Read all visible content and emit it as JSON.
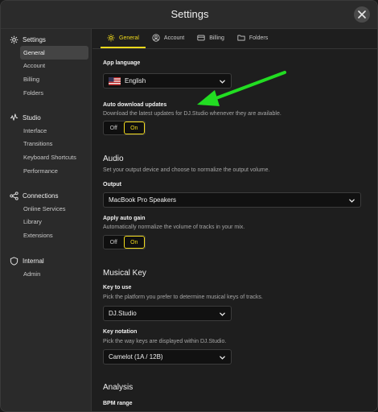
{
  "window": {
    "title": "Settings"
  },
  "sidebar": {
    "groups": [
      {
        "label": "Settings",
        "icon": "gear-icon",
        "items": [
          {
            "label": "General",
            "active": true
          },
          {
            "label": "Account"
          },
          {
            "label": "Billing"
          },
          {
            "label": "Folders"
          }
        ]
      },
      {
        "label": "Studio",
        "icon": "waveform-icon",
        "items": [
          {
            "label": "Interface"
          },
          {
            "label": "Transitions"
          },
          {
            "label": "Keyboard Shortcuts"
          },
          {
            "label": "Performance"
          }
        ]
      },
      {
        "label": "Connections",
        "icon": "share-icon",
        "items": [
          {
            "label": "Online Services"
          },
          {
            "label": "Library"
          },
          {
            "label": "Extensions"
          }
        ]
      },
      {
        "label": "Internal",
        "icon": "shield-icon",
        "items": [
          {
            "label": "Admin"
          }
        ]
      }
    ]
  },
  "tabs": [
    {
      "label": "General",
      "icon": "gear-icon",
      "active": true
    },
    {
      "label": "Account",
      "icon": "user-icon"
    },
    {
      "label": "Billing",
      "icon": "card-icon"
    },
    {
      "label": "Folders",
      "icon": "folder-icon"
    }
  ],
  "general": {
    "app_language": {
      "label": "App language",
      "value": "English"
    },
    "auto_download": {
      "label": "Auto download updates",
      "description": "Download the latest updates for DJ.Studio whenever they are available.",
      "off": "Off",
      "on": "On",
      "state": "on"
    },
    "audio": {
      "heading": "Audio",
      "description": "Set your output device and choose to normalize the output volume.",
      "output_label": "Output",
      "output_value": "MacBook Pro Speakers",
      "gain_label": "Apply auto gain",
      "gain_description": "Automatically normalize the volume of tracks in your mix.",
      "off": "Off",
      "on": "On",
      "state": "on"
    },
    "musical_key": {
      "heading": "Musical Key",
      "key_label": "Key to use",
      "key_description": "Pick the platform you prefer to determine musical keys of tracks.",
      "key_value": "DJ.Studio",
      "notation_label": "Key notation",
      "notation_description": "Pick the way keys are displayed within DJ.Studio.",
      "notation_value": "Camelot (1A / 12B)"
    },
    "analysis": {
      "heading": "Analysis",
      "bpm_label": "BPM range"
    }
  },
  "colors": {
    "accent": "#f0d91c",
    "annotation_arrow": "#22dd22"
  }
}
